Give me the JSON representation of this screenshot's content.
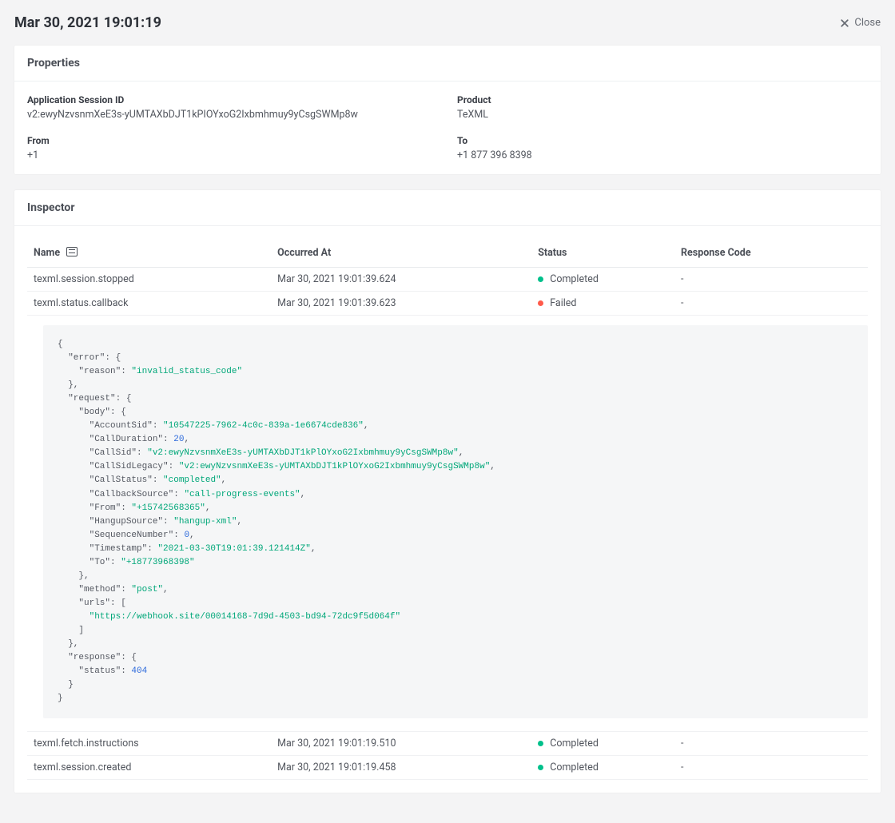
{
  "header": {
    "title": "Mar 30, 2021 19:01:19",
    "close_label": "Close"
  },
  "properties": {
    "section_title": "Properties",
    "application_session_id": {
      "label": "Application Session ID",
      "value": "v2:ewyNzvsnmXeE3s-yUMTAXbDJT1kPIOYxoG2Ixbmhmuy9yCsgSWMp8w"
    },
    "product": {
      "label": "Product",
      "value": "TeXML"
    },
    "from": {
      "label": "From",
      "value": "+1"
    },
    "to": {
      "label": "To",
      "value": "+1 877 396 8398"
    }
  },
  "inspector": {
    "section_title": "Inspector",
    "columns": {
      "name": "Name",
      "occurred_at": "Occurred At",
      "status": "Status",
      "response_code": "Response Code"
    },
    "rows": [
      {
        "name": "texml.session.stopped",
        "occurred_at": "Mar 30, 2021 19:01:39.624",
        "status": "Completed",
        "status_kind": "completed",
        "response_code": "-"
      },
      {
        "name": "texml.status.callback",
        "occurred_at": "Mar 30, 2021 19:01:39.623",
        "status": "Failed",
        "status_kind": "failed",
        "response_code": "-"
      },
      {
        "name": "texml.fetch.instructions",
        "occurred_at": "Mar 30, 2021 19:01:19.510",
        "status": "Completed",
        "status_kind": "completed",
        "response_code": "-"
      },
      {
        "name": "texml.session.created",
        "occurred_at": "Mar 30, 2021 19:01:19.458",
        "status": "Completed",
        "status_kind": "completed",
        "response_code": "-"
      }
    ],
    "detail_payload": {
      "error": {
        "reason": "invalid_status_code"
      },
      "request": {
        "body": {
          "AccountSid": "10547225-7962-4c0c-839a-1e6674cde836",
          "CallDuration": 20,
          "CallSid": "v2:ewyNzvsnmXeE3s-yUMTAXbDJT1kPlOYxoG2Ixbmhmuy9yCsgSWMp8w",
          "CallSidLegacy": "v2:ewyNzvsnmXeE3s-yUMTAXbDJT1kPlOYxoG2Ixbmhmuy9yCsgSWMp8w",
          "CallStatus": "completed",
          "CallbackSource": "call-progress-events",
          "From": "+15742568365",
          "HangupSource": "hangup-xml",
          "SequenceNumber": 0,
          "Timestamp": "2021-03-30T19:01:39.121414Z",
          "To": "+18773968398"
        },
        "method": "post",
        "urls": [
          "https://webhook.site/00014168-7d9d-4503-bd94-72dc9f5d064f"
        ]
      },
      "response": {
        "status": 404
      }
    }
  }
}
